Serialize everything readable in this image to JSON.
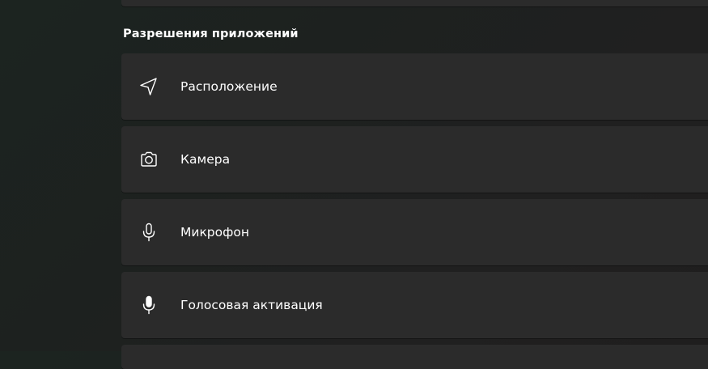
{
  "section": {
    "title": "Разрешения приложений"
  },
  "items": [
    {
      "label": "Расположение",
      "icon": "location-arrow-icon"
    },
    {
      "label": "Камера",
      "icon": "camera-icon"
    },
    {
      "label": "Микрофон",
      "icon": "microphone-icon"
    },
    {
      "label": "Голосовая активация",
      "icon": "voice-activation-icon"
    }
  ],
  "colors": {
    "card": "#2b2b2b",
    "text": "#ffffff",
    "background": "#1f2220"
  }
}
